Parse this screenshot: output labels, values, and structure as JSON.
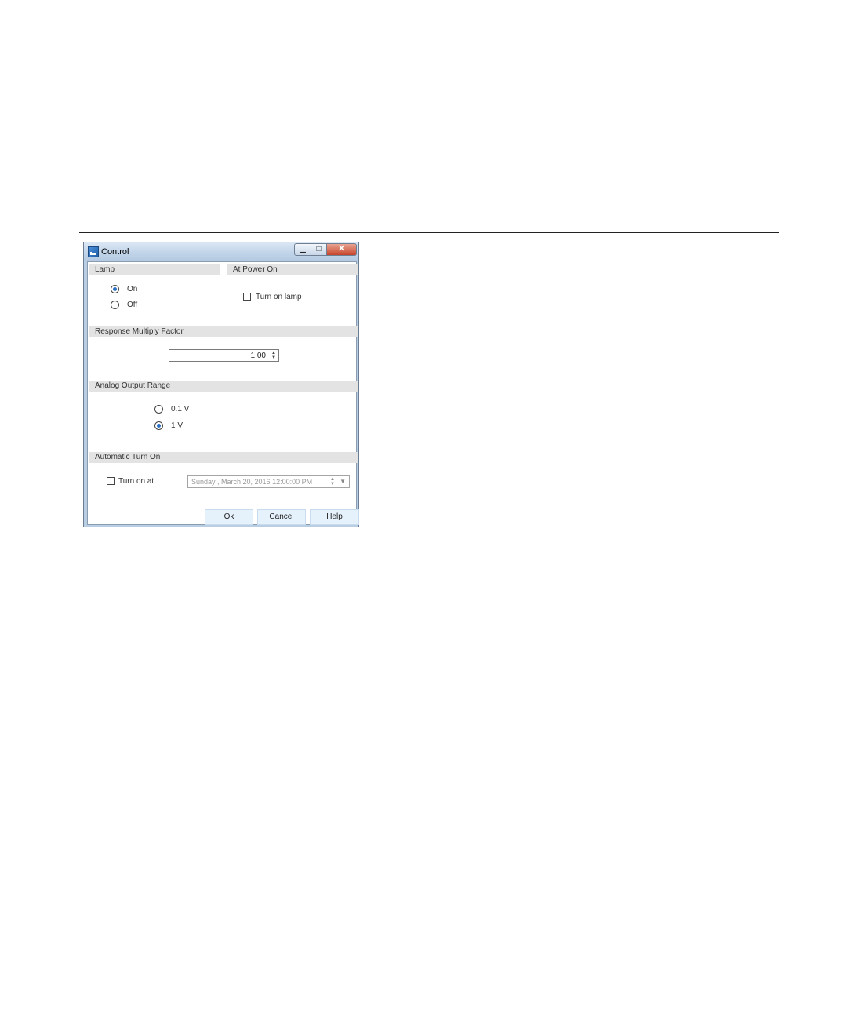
{
  "window": {
    "title": "Control",
    "minimize_glyph": "▁",
    "maximize_glyph": "□",
    "close_glyph": "✕"
  },
  "lamp": {
    "header": "Lamp",
    "options": [
      {
        "label": "On",
        "checked": true
      },
      {
        "label": "Off",
        "checked": false
      }
    ]
  },
  "power_on": {
    "header": "At Power On",
    "turn_on_lamp_label": "Turn on lamp",
    "turn_on_lamp_checked": false
  },
  "response": {
    "header": "Response Multiply Factor",
    "value": "1.00"
  },
  "analog": {
    "header": "Analog Output Range",
    "options": [
      {
        "label": "0.1 V",
        "checked": false
      },
      {
        "label": "1 V",
        "checked": true
      }
    ]
  },
  "auto_turn_on": {
    "header": "Automatic Turn On",
    "turn_on_at_label": "Turn on at",
    "turn_on_at_checked": false,
    "datetime": "Sunday , March 20, 2016   12:00:00 PM"
  },
  "buttons": {
    "ok": "Ok",
    "cancel": "Cancel",
    "help": "Help"
  },
  "colors": {
    "accent": "#2a6fc0",
    "header_bg": "#e3e3e3",
    "button_bg": "#e5f1fb",
    "close_button": "#c7452b"
  }
}
